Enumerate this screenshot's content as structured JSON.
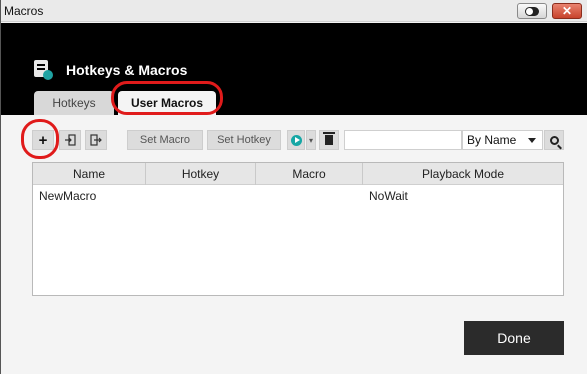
{
  "window": {
    "title": "Macros"
  },
  "header": {
    "title": "Hotkeys & Macros"
  },
  "tabs": [
    {
      "label": "Hotkeys",
      "active": false
    },
    {
      "label": "User Macros",
      "active": true
    }
  ],
  "toolbar": {
    "set_macro_label": "Set Macro",
    "set_hotkey_label": "Set Hotkey",
    "search_value": "",
    "sort_selected": "By Name"
  },
  "table": {
    "columns": [
      "Name",
      "Hotkey",
      "Macro",
      "Playback Mode"
    ],
    "rows": [
      {
        "name": "NewMacro",
        "hotkey": "",
        "macro": "",
        "playback_mode": "NoWait"
      }
    ]
  },
  "footer": {
    "done_label": "Done"
  },
  "colors": {
    "header_bg": "#000000",
    "accent_play": "#16a7a5",
    "callout": "#e01b1b",
    "close_button": "#c7432c"
  }
}
